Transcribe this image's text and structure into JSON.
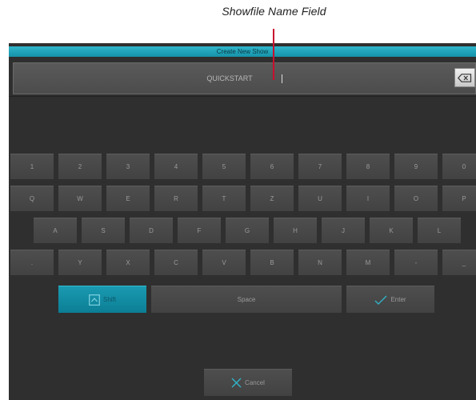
{
  "annotation": {
    "label": "Showfile Name Field"
  },
  "dialog": {
    "title": "Create New Show",
    "filename_value": "QUICKSTART",
    "filename_placeholder": ""
  },
  "keyboard": {
    "row1": [
      "1",
      "2",
      "3",
      "4",
      "5",
      "6",
      "7",
      "8",
      "9",
      "0"
    ],
    "row2": [
      "Q",
      "W",
      "E",
      "R",
      "T",
      "Z",
      "U",
      "I",
      "O",
      "P"
    ],
    "row3": [
      "A",
      "S",
      "D",
      "F",
      "G",
      "H",
      "J",
      "K",
      "L"
    ],
    "row4": [
      ".",
      "Y",
      "X",
      "C",
      "V",
      "B",
      "N",
      "M",
      "-",
      "_"
    ],
    "shift_label": "Shift",
    "space_label": "Space",
    "enter_label": "Enter"
  },
  "cancel_label": "Cancel",
  "colors": {
    "accent": "#1a9ab2",
    "background": "#2f2f2f",
    "key": "#4a4a4a",
    "leader_line": "#c8102e"
  }
}
